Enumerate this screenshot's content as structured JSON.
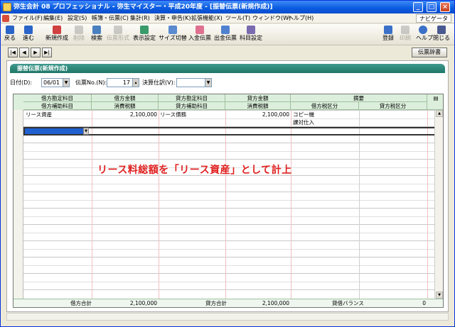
{
  "window": {
    "title": "弥生会計 08 プロフェッショナル - 弥生マイスター・平成20年度 - [振替伝票(新規作成)]"
  },
  "menu": {
    "items": [
      "ファイル(F)",
      "編集(E)",
      "設定(S)",
      "帳簿・伝票(C)",
      "集計(R)",
      "決算・申告(K)",
      "拡張機能(X)",
      "ツール(T)",
      "ウィンドウ(W)",
      "ヘルプ(H)"
    ],
    "navi": "ナビゲータ"
  },
  "toolbar": {
    "left": [
      "戻る",
      "進む",
      "新規作成",
      "削除",
      "検索",
      "伝票形式",
      "表示設定",
      "サイズ切替",
      "入金伝票",
      "出金伝票",
      "科目設定"
    ],
    "right": [
      "登録",
      "印刷",
      "ヘルプ",
      "閉じる"
    ]
  },
  "nav": {
    "first": "|◀",
    "prev": "◀",
    "next": "▶",
    "last": "▶|",
    "dict": "伝票辞書"
  },
  "slip": {
    "header": "振替伝票(新規作成)",
    "date_label": "日付(D):",
    "date_value": "06/01",
    "no_label": "伝票No.(N):",
    "no_value": "17",
    "settle_label": "決算仕訳(V):",
    "settle_value": ""
  },
  "grid": {
    "headers_top": [
      "借方勘定科目",
      "借方金額",
      "貸方勘定科目",
      "貸方金額",
      "摘要"
    ],
    "headers_bottom": [
      "借方補助科目",
      "消費税額",
      "貸方補助科目",
      "消費税額",
      "借方税区分",
      "貸方税区分"
    ],
    "rows": [
      {
        "debit_account": "リース資産",
        "debit_amount": "2,100,000",
        "credit_account": "リース債務",
        "credit_amount": "2,100,000",
        "memo": "コピー機",
        "debit_tax": "課対仕入"
      }
    ],
    "footer": {
      "debit_total_label": "借方合計",
      "debit_total": "2,100,000",
      "credit_total_label": "貸方合計",
      "credit_total": "2,100,000",
      "balance_label": "貸借バランス",
      "balance": "0"
    }
  },
  "annotation": "リース料総額を「リース資産」として計上",
  "colors": {
    "accent": "#1e7666",
    "annotation": "#e02020",
    "title": "#0a5ae0"
  }
}
